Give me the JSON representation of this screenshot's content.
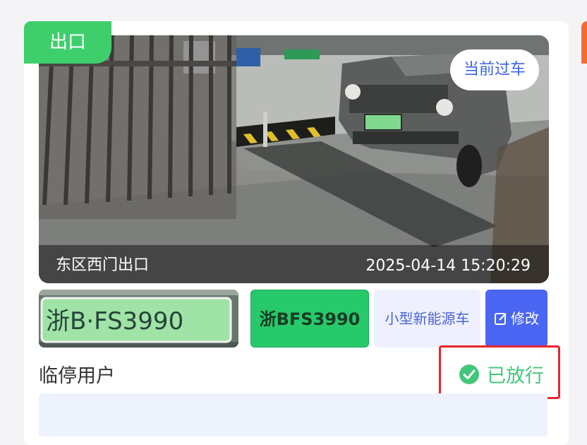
{
  "direction_tag": "出口",
  "camera": {
    "status": "当前过车",
    "location": "东区西门出口",
    "timestamp": "2025-04-14 15:20:29"
  },
  "plate": {
    "crop_text": "浙B·FS3990",
    "number": "浙BFS3990",
    "vehicle_type": "小型新能源车"
  },
  "actions": {
    "edit_label": "修改"
  },
  "record": {
    "user_type": "临停用户",
    "pass_status": "已放行"
  },
  "colors": {
    "accent_green": "#3ecf6c",
    "plate_green": "#27c96a",
    "primary_blue": "#4a66f2",
    "highlight_red": "#e8242d"
  }
}
